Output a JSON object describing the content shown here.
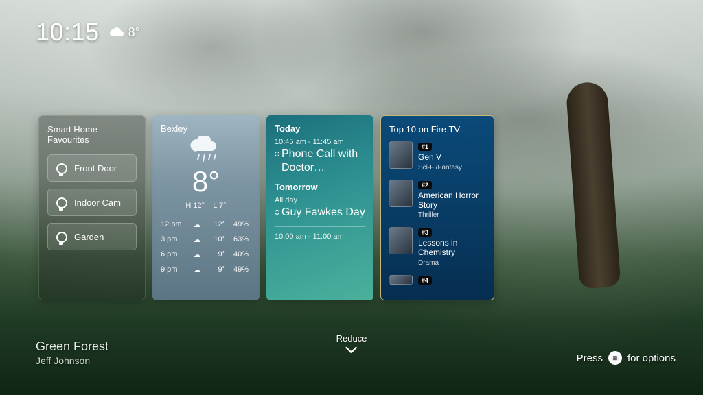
{
  "status": {
    "time": "10:15",
    "temp": "8°"
  },
  "smart_home": {
    "title": "Smart Home Favourites",
    "items": [
      {
        "label": "Front Door"
      },
      {
        "label": "Indoor Cam"
      },
      {
        "label": "Garden"
      }
    ]
  },
  "weather": {
    "location": "Bexley",
    "temp": "8°",
    "high_label": "H 12°",
    "low_label": "L 7°",
    "hourly": [
      {
        "time": "12 pm",
        "temp": "12°",
        "humidity": "49%"
      },
      {
        "time": "3 pm",
        "temp": "10°",
        "humidity": "63%"
      },
      {
        "time": "6 pm",
        "temp": "9°",
        "humidity": "40%"
      },
      {
        "time": "9 pm",
        "temp": "9°",
        "humidity": "49%"
      }
    ]
  },
  "calendar": {
    "today_label": "Today",
    "today_time": "10:45 am - 11:45 am",
    "today_event": "Phone Call with Doctor…",
    "tomorrow_label": "Tomorrow",
    "tomorrow_time": "All day",
    "tomorrow_event": "Guy Fawkes Day",
    "next_time": "10:00 am - 11:00 am"
  },
  "top10": {
    "title": "Top 10 on Fire TV",
    "items": [
      {
        "rank": "#1",
        "name": "Gen V",
        "genre": "Sci-Fi/Fantasy"
      },
      {
        "rank": "#2",
        "name": "American Horror Story",
        "genre": "Thriller"
      },
      {
        "rank": "#3",
        "name": "Lessons in Chemistry",
        "genre": "Drama"
      },
      {
        "rank": "#4",
        "name": "",
        "genre": ""
      }
    ]
  },
  "ambient": {
    "name": "Green Forest",
    "artist": "Jeff Johnson"
  },
  "controls": {
    "reduce": "Reduce",
    "options_pre": "Press",
    "options_post": "for options"
  }
}
